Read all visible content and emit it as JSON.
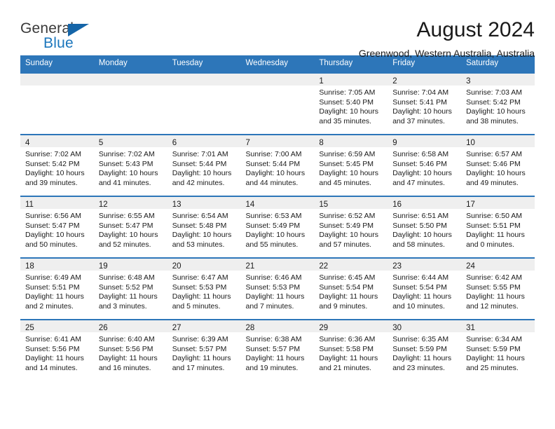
{
  "brand": {
    "name_part1": "General",
    "name_part2": "Blue",
    "logo_icon": "blue-triangle-logo"
  },
  "header": {
    "title": "August 2024",
    "subtitle": "Greenwood, Western Australia, Australia"
  },
  "colors": {
    "header_blue": "#2d76b9",
    "brand_blue": "#1b76bc",
    "day_band_gray": "#efefef",
    "text": "#1a1a1a"
  },
  "weekday_headers": [
    "Sunday",
    "Monday",
    "Tuesday",
    "Wednesday",
    "Thursday",
    "Friday",
    "Saturday"
  ],
  "weeks": [
    [
      {
        "day": "",
        "empty": true
      },
      {
        "day": "",
        "empty": true
      },
      {
        "day": "",
        "empty": true
      },
      {
        "day": "",
        "empty": true
      },
      {
        "day": "1",
        "sunrise": "Sunrise: 7:05 AM",
        "sunset": "Sunset: 5:40 PM",
        "daylight_line1": "Daylight: 10 hours",
        "daylight_line2": "and 35 minutes."
      },
      {
        "day": "2",
        "sunrise": "Sunrise: 7:04 AM",
        "sunset": "Sunset: 5:41 PM",
        "daylight_line1": "Daylight: 10 hours",
        "daylight_line2": "and 37 minutes."
      },
      {
        "day": "3",
        "sunrise": "Sunrise: 7:03 AM",
        "sunset": "Sunset: 5:42 PM",
        "daylight_line1": "Daylight: 10 hours",
        "daylight_line2": "and 38 minutes."
      }
    ],
    [
      {
        "day": "4",
        "sunrise": "Sunrise: 7:02 AM",
        "sunset": "Sunset: 5:42 PM",
        "daylight_line1": "Daylight: 10 hours",
        "daylight_line2": "and 39 minutes."
      },
      {
        "day": "5",
        "sunrise": "Sunrise: 7:02 AM",
        "sunset": "Sunset: 5:43 PM",
        "daylight_line1": "Daylight: 10 hours",
        "daylight_line2": "and 41 minutes."
      },
      {
        "day": "6",
        "sunrise": "Sunrise: 7:01 AM",
        "sunset": "Sunset: 5:44 PM",
        "daylight_line1": "Daylight: 10 hours",
        "daylight_line2": "and 42 minutes."
      },
      {
        "day": "7",
        "sunrise": "Sunrise: 7:00 AM",
        "sunset": "Sunset: 5:44 PM",
        "daylight_line1": "Daylight: 10 hours",
        "daylight_line2": "and 44 minutes."
      },
      {
        "day": "8",
        "sunrise": "Sunrise: 6:59 AM",
        "sunset": "Sunset: 5:45 PM",
        "daylight_line1": "Daylight: 10 hours",
        "daylight_line2": "and 45 minutes."
      },
      {
        "day": "9",
        "sunrise": "Sunrise: 6:58 AM",
        "sunset": "Sunset: 5:46 PM",
        "daylight_line1": "Daylight: 10 hours",
        "daylight_line2": "and 47 minutes."
      },
      {
        "day": "10",
        "sunrise": "Sunrise: 6:57 AM",
        "sunset": "Sunset: 5:46 PM",
        "daylight_line1": "Daylight: 10 hours",
        "daylight_line2": "and 49 minutes."
      }
    ],
    [
      {
        "day": "11",
        "sunrise": "Sunrise: 6:56 AM",
        "sunset": "Sunset: 5:47 PM",
        "daylight_line1": "Daylight: 10 hours",
        "daylight_line2": "and 50 minutes."
      },
      {
        "day": "12",
        "sunrise": "Sunrise: 6:55 AM",
        "sunset": "Sunset: 5:47 PM",
        "daylight_line1": "Daylight: 10 hours",
        "daylight_line2": "and 52 minutes."
      },
      {
        "day": "13",
        "sunrise": "Sunrise: 6:54 AM",
        "sunset": "Sunset: 5:48 PM",
        "daylight_line1": "Daylight: 10 hours",
        "daylight_line2": "and 53 minutes."
      },
      {
        "day": "14",
        "sunrise": "Sunrise: 6:53 AM",
        "sunset": "Sunset: 5:49 PM",
        "daylight_line1": "Daylight: 10 hours",
        "daylight_line2": "and 55 minutes."
      },
      {
        "day": "15",
        "sunrise": "Sunrise: 6:52 AM",
        "sunset": "Sunset: 5:49 PM",
        "daylight_line1": "Daylight: 10 hours",
        "daylight_line2": "and 57 minutes."
      },
      {
        "day": "16",
        "sunrise": "Sunrise: 6:51 AM",
        "sunset": "Sunset: 5:50 PM",
        "daylight_line1": "Daylight: 10 hours",
        "daylight_line2": "and 58 minutes."
      },
      {
        "day": "17",
        "sunrise": "Sunrise: 6:50 AM",
        "sunset": "Sunset: 5:51 PM",
        "daylight_line1": "Daylight: 11 hours",
        "daylight_line2": "and 0 minutes."
      }
    ],
    [
      {
        "day": "18",
        "sunrise": "Sunrise: 6:49 AM",
        "sunset": "Sunset: 5:51 PM",
        "daylight_line1": "Daylight: 11 hours",
        "daylight_line2": "and 2 minutes."
      },
      {
        "day": "19",
        "sunrise": "Sunrise: 6:48 AM",
        "sunset": "Sunset: 5:52 PM",
        "daylight_line1": "Daylight: 11 hours",
        "daylight_line2": "and 3 minutes."
      },
      {
        "day": "20",
        "sunrise": "Sunrise: 6:47 AM",
        "sunset": "Sunset: 5:53 PM",
        "daylight_line1": "Daylight: 11 hours",
        "daylight_line2": "and 5 minutes."
      },
      {
        "day": "21",
        "sunrise": "Sunrise: 6:46 AM",
        "sunset": "Sunset: 5:53 PM",
        "daylight_line1": "Daylight: 11 hours",
        "daylight_line2": "and 7 minutes."
      },
      {
        "day": "22",
        "sunrise": "Sunrise: 6:45 AM",
        "sunset": "Sunset: 5:54 PM",
        "daylight_line1": "Daylight: 11 hours",
        "daylight_line2": "and 9 minutes."
      },
      {
        "day": "23",
        "sunrise": "Sunrise: 6:44 AM",
        "sunset": "Sunset: 5:54 PM",
        "daylight_line1": "Daylight: 11 hours",
        "daylight_line2": "and 10 minutes."
      },
      {
        "day": "24",
        "sunrise": "Sunrise: 6:42 AM",
        "sunset": "Sunset: 5:55 PM",
        "daylight_line1": "Daylight: 11 hours",
        "daylight_line2": "and 12 minutes."
      }
    ],
    [
      {
        "day": "25",
        "sunrise": "Sunrise: 6:41 AM",
        "sunset": "Sunset: 5:56 PM",
        "daylight_line1": "Daylight: 11 hours",
        "daylight_line2": "and 14 minutes."
      },
      {
        "day": "26",
        "sunrise": "Sunrise: 6:40 AM",
        "sunset": "Sunset: 5:56 PM",
        "daylight_line1": "Daylight: 11 hours",
        "daylight_line2": "and 16 minutes."
      },
      {
        "day": "27",
        "sunrise": "Sunrise: 6:39 AM",
        "sunset": "Sunset: 5:57 PM",
        "daylight_line1": "Daylight: 11 hours",
        "daylight_line2": "and 17 minutes."
      },
      {
        "day": "28",
        "sunrise": "Sunrise: 6:38 AM",
        "sunset": "Sunset: 5:57 PM",
        "daylight_line1": "Daylight: 11 hours",
        "daylight_line2": "and 19 minutes."
      },
      {
        "day": "29",
        "sunrise": "Sunrise: 6:36 AM",
        "sunset": "Sunset: 5:58 PM",
        "daylight_line1": "Daylight: 11 hours",
        "daylight_line2": "and 21 minutes."
      },
      {
        "day": "30",
        "sunrise": "Sunrise: 6:35 AM",
        "sunset": "Sunset: 5:59 PM",
        "daylight_line1": "Daylight: 11 hours",
        "daylight_line2": "and 23 minutes."
      },
      {
        "day": "31",
        "sunrise": "Sunrise: 6:34 AM",
        "sunset": "Sunset: 5:59 PM",
        "daylight_line1": "Daylight: 11 hours",
        "daylight_line2": "and 25 minutes."
      }
    ]
  ]
}
